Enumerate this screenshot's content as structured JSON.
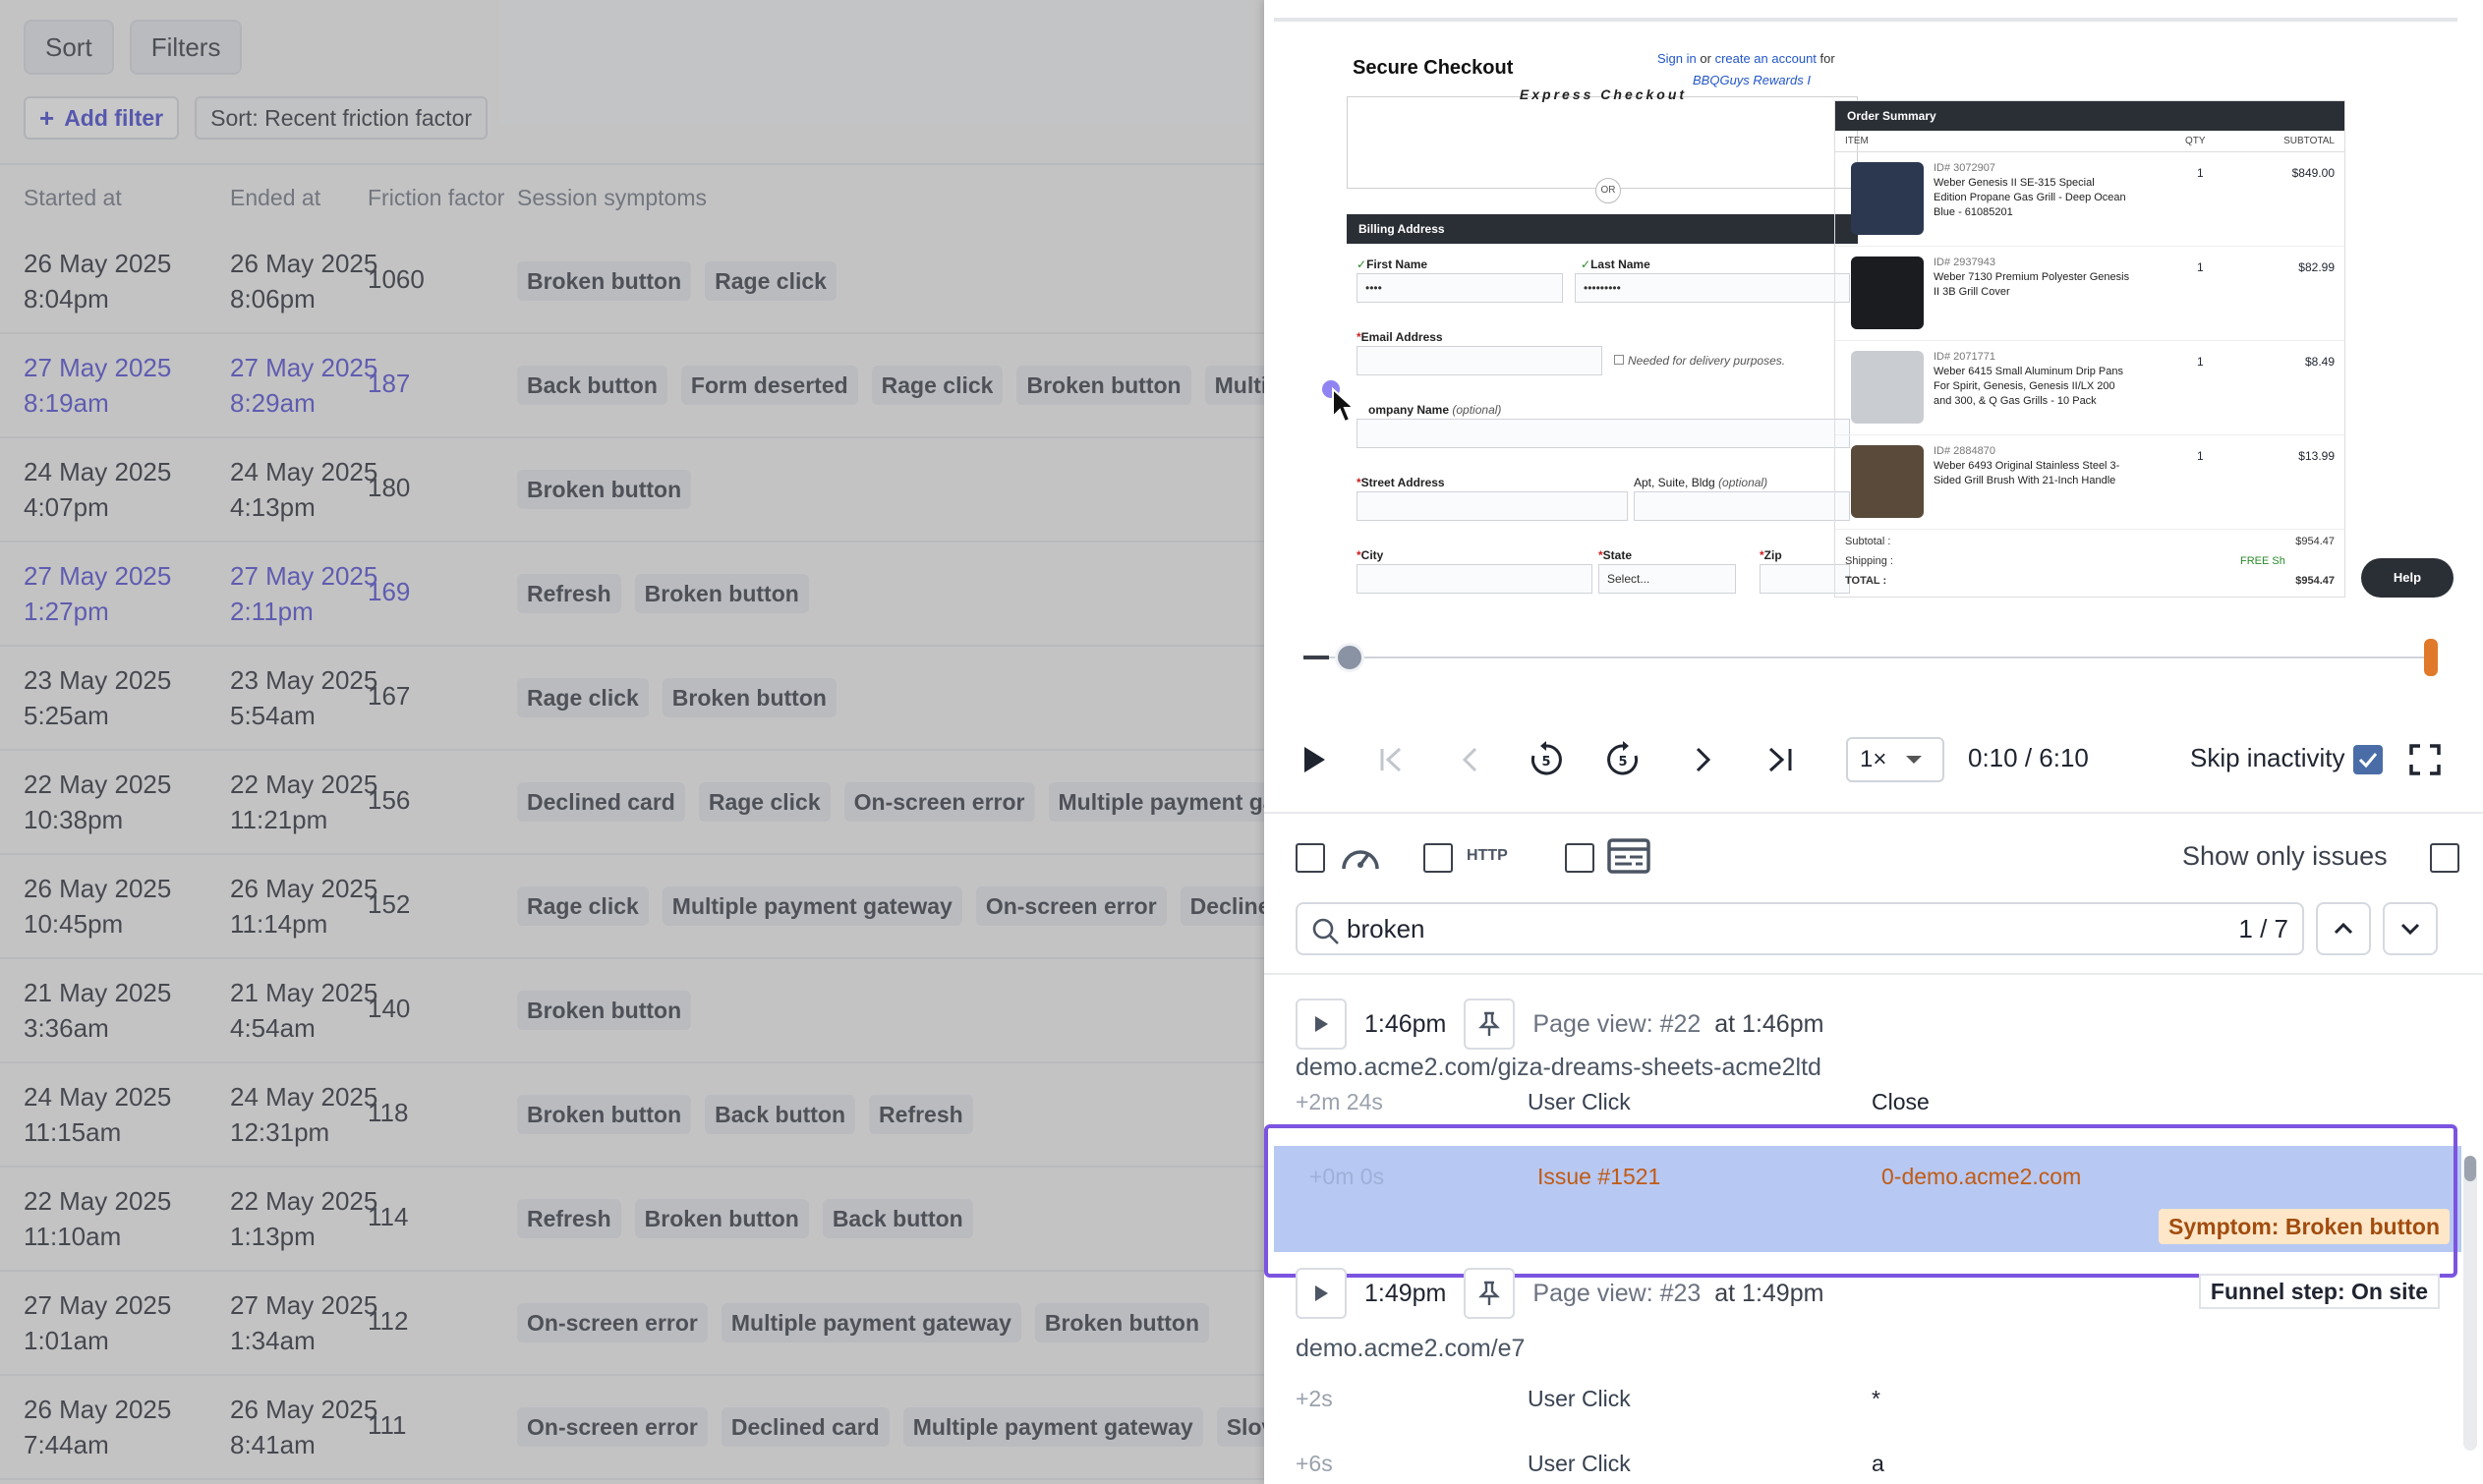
{
  "toolbar": {
    "sort_label": "Sort",
    "filters_label": "Filters",
    "add_filter_label": "Add filter",
    "sort_chip_label": "Sort: Recent friction factor"
  },
  "table": {
    "headers": {
      "started": "Started at",
      "ended": "Ended at",
      "friction": "Friction factor",
      "symptoms": "Session symptoms"
    },
    "rows": [
      {
        "started_date": "26 May 2025",
        "started_time": "8:04pm",
        "ended_date": "26 May 2025",
        "ended_time": "8:06pm",
        "friction": "1060",
        "symptoms": [
          "Broken button",
          "Rage click"
        ]
      },
      {
        "started_date": "27 May 2025",
        "started_time": "8:19am",
        "ended_date": "27 May 2025",
        "ended_time": "8:29am",
        "friction": "187",
        "symptoms": [
          "Back button",
          "Form deserted",
          "Rage click",
          "Broken button",
          "Multip"
        ]
      },
      {
        "started_date": "24 May 2025",
        "started_time": "4:07pm",
        "ended_date": "24 May 2025",
        "ended_time": "4:13pm",
        "friction": "180",
        "symptoms": [
          "Broken button"
        ]
      },
      {
        "started_date": "27 May 2025",
        "started_time": "1:27pm",
        "ended_date": "27 May 2025",
        "ended_time": "2:11pm",
        "friction": "169",
        "symptoms": [
          "Refresh",
          "Broken button"
        ]
      },
      {
        "started_date": "23 May 2025",
        "started_time": "5:25am",
        "ended_date": "23 May 2025",
        "ended_time": "5:54am",
        "friction": "167",
        "symptoms": [
          "Rage click",
          "Broken button"
        ]
      },
      {
        "started_date": "22 May 2025",
        "started_time": "10:38pm",
        "ended_date": "22 May 2025",
        "ended_time": "11:21pm",
        "friction": "156",
        "symptoms": [
          "Declined card",
          "Rage click",
          "On-screen error",
          "Multiple payment ga"
        ]
      },
      {
        "started_date": "26 May 2025",
        "started_time": "10:45pm",
        "ended_date": "26 May 2025",
        "ended_time": "11:14pm",
        "friction": "152",
        "symptoms": [
          "Rage click",
          "Multiple payment gateway",
          "On-screen error",
          "Decline"
        ]
      },
      {
        "started_date": "21 May 2025",
        "started_time": "3:36am",
        "ended_date": "21 May 2025",
        "ended_time": "4:54am",
        "friction": "140",
        "symptoms": [
          "Broken button"
        ]
      },
      {
        "started_date": "24 May 2025",
        "started_time": "11:15am",
        "ended_date": "24 May 2025",
        "ended_time": "12:31pm",
        "friction": "118",
        "symptoms": [
          "Broken button",
          "Back button",
          "Refresh"
        ]
      },
      {
        "started_date": "22 May 2025",
        "started_time": "11:10am",
        "ended_date": "22 May 2025",
        "ended_time": "1:13pm",
        "friction": "114",
        "symptoms": [
          "Refresh",
          "Broken button",
          "Back button"
        ]
      },
      {
        "started_date": "27 May 2025",
        "started_time": "1:01am",
        "ended_date": "27 May 2025",
        "ended_time": "1:34am",
        "friction": "112",
        "symptoms": [
          "On-screen error",
          "Multiple payment gateway",
          "Broken button"
        ]
      },
      {
        "started_date": "26 May 2025",
        "started_time": "7:44am",
        "ended_date": "26 May 2025",
        "ended_time": "8:41am",
        "friction": "111",
        "symptoms": [
          "On-screen error",
          "Declined card",
          "Multiple payment gateway",
          "Slov"
        ]
      }
    ]
  },
  "replay": {
    "title": "Secure Checkout",
    "sign_in": "Sign in",
    "or_text": "or",
    "create_account": "create an account",
    "for_text": "for",
    "bbq_rewards": "BBQGuys Rewards I",
    "express": "Express Checkout",
    "or_badge": "OR",
    "billing_header": "Billing Address",
    "first_name": "First Name",
    "last_name": "Last Name",
    "first_name_val": "••••",
    "last_name_val": "•••••••••",
    "email": "Email Address",
    "delivery_note": "Needed for delivery purposes.",
    "company": "ompany Name",
    "optional": "(optional)",
    "street": "Street Address",
    "apt": "Apt, Suite, Bldg",
    "city": "City",
    "state": "State",
    "state_val": "Select...",
    "zip": "Zip",
    "order_summary": "Order Summary",
    "col_item": "ITEM",
    "col_qty": "QTY",
    "col_subtotal": "SUBTOTAL",
    "items": [
      {
        "id": "ID# 3072907",
        "name": "Weber Genesis II SE-315 Special Edition Propane Gas Grill - Deep Ocean Blue - 61085201",
        "qty": "1",
        "subtotal": "$849.00"
      },
      {
        "id": "ID# 2937943",
        "name": "Weber 7130 Premium Polyester Genesis II 3B Grill Cover",
        "qty": "1",
        "subtotal": "$82.99"
      },
      {
        "id": "ID# 2071771",
        "name": "Weber 6415 Small Aluminum Drip Pans For Spirit, Genesis, Genesis II/LX 200 and 300, & Q Gas Grills - 10 Pack",
        "qty": "1",
        "subtotal": "$8.49"
      },
      {
        "id": "ID# 2884870",
        "name": "Weber 6493 Original Stainless Steel 3-Sided Grill Brush With 21-Inch Handle",
        "qty": "1",
        "subtotal": "$13.99"
      }
    ],
    "subtotal_label": "Subtotal :",
    "subtotal_val": "$954.47",
    "shipping_label": "Shipping :",
    "shipping_val": "FREE Sh",
    "total_label": "TOTAL :",
    "total_val": "$954.47",
    "help": "Help"
  },
  "player": {
    "progress": 0.027,
    "speed": "1×",
    "time": "0:10 / 6:10",
    "skip_inactivity": "Skip inactivity",
    "http_label": "HTTP",
    "show_only_issues": "Show only issues",
    "search_value": "broken",
    "search_count": "1 / 7"
  },
  "log": {
    "pv1_time": "1:46pm",
    "pv1_label": "Page view: #22",
    "pv1_at": "at 1:46pm",
    "url1": "demo.acme2.com/giza-dreams-sheets-acme2ltd",
    "ev0_time": "+2m 24s",
    "ev0_kind": "User Click",
    "ev0_val": "Close",
    "issue_time": "+0m 0s",
    "issue_kind": "Issue #1521",
    "issue_val": "0-demo.acme2.com",
    "symptom": "Symptom: Broken button",
    "pv2_time": "1:49pm",
    "pv2_label": "Page view: #23",
    "pv2_at": "at 1:49pm",
    "funnel": "Funnel step: On site",
    "url2": "demo.acme2.com/e7",
    "ev1_time": "+2s",
    "ev1_kind": "User Click",
    "ev1_val": "*",
    "ev2_time": "+6s",
    "ev2_kind": "User Click",
    "ev2_val": "a"
  },
  "colors": {
    "accent": "#4a46d6",
    "highlight_border": "#7b54e0",
    "issue_bg": "#b7c8f2",
    "symptom_bg": "#fde7c8",
    "timeline_end": "#e07a2a"
  }
}
